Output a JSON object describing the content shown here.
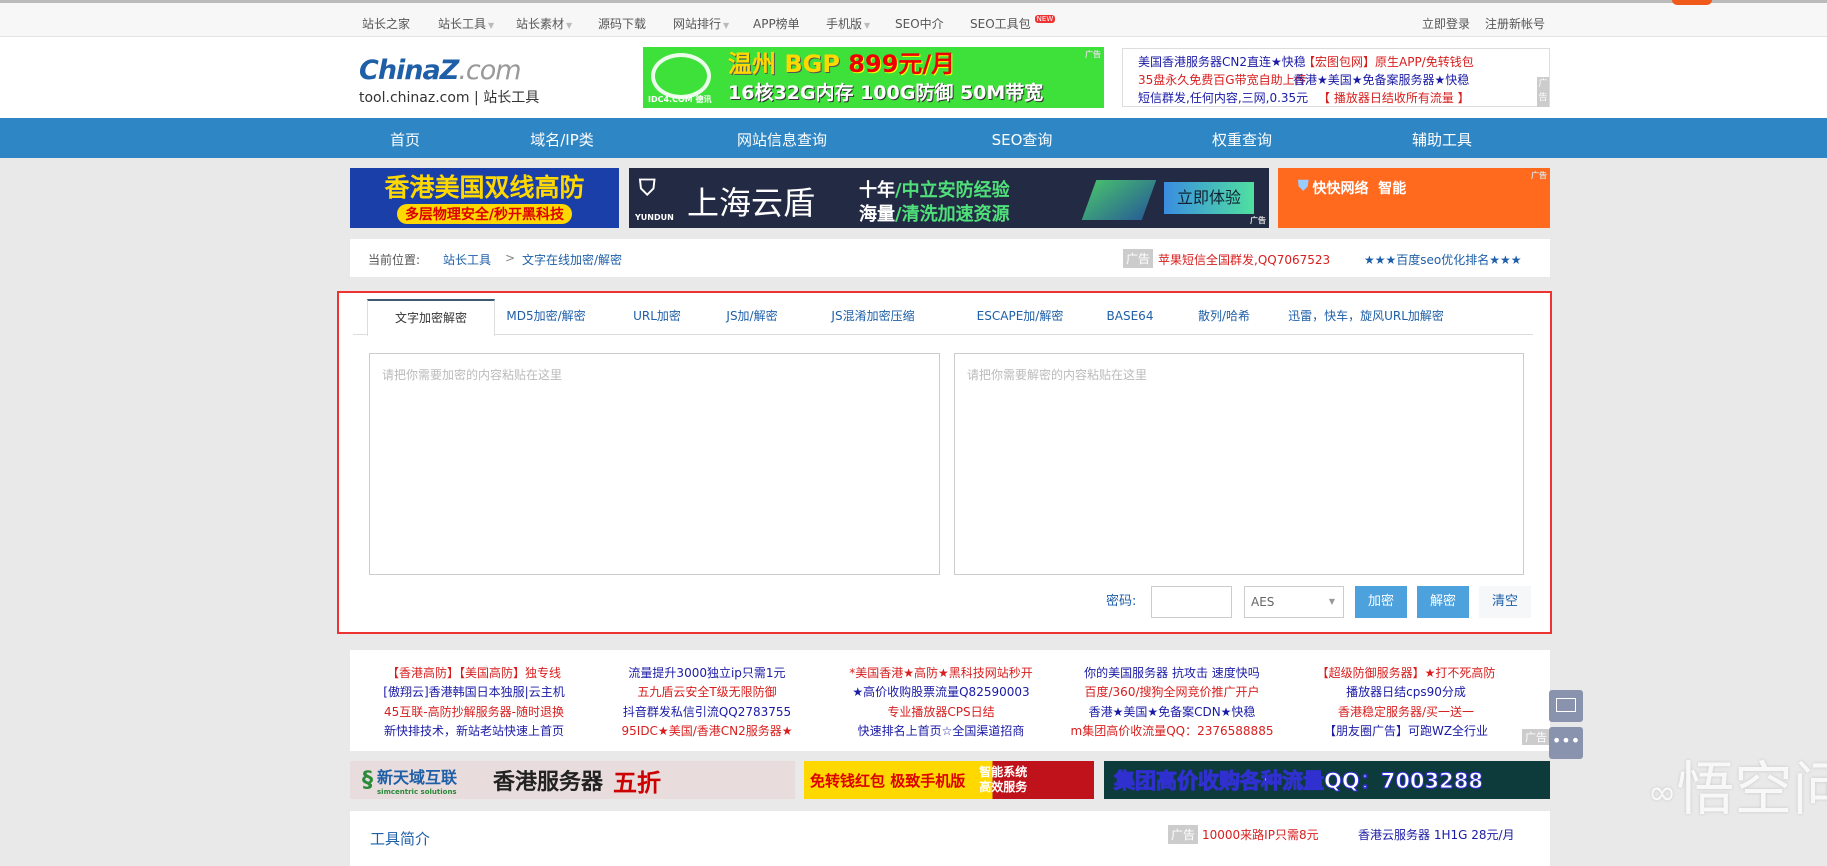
{
  "topnav": {
    "items": [
      {
        "label": "站长之家",
        "caret": false
      },
      {
        "label": "站长工具",
        "caret": true
      },
      {
        "label": "站长素材",
        "caret": true
      },
      {
        "label": "源码下载",
        "caret": false
      },
      {
        "label": "网站排行",
        "caret": true
      },
      {
        "label": "APP榜单",
        "caret": false
      },
      {
        "label": "手机版",
        "caret": true
      },
      {
        "label": "SEO中介",
        "caret": false
      },
      {
        "label": "SEO工具包",
        "caret": false
      }
    ],
    "new_badge": "NEW",
    "login": "立即登录",
    "register": "注册新帐号"
  },
  "logo": {
    "brand": "ChinaZ",
    "brand_suffix": ".com",
    "sub": "tool.chinaz.com | 站长工具"
  },
  "header_banner": {
    "line1_a": "温州 BGP ",
    "line1_b": "899元/月",
    "line2": "16核32G内存 100G防御 50M带宽",
    "brand": "IDC4.COM 德讯",
    "tag": "广告"
  },
  "header_text_ads": [
    {
      "text": "美国香港服务器CN2直连★快稳",
      "color": "#1a1aa6"
    },
    {
      "text": "【宏图包网】原生APP/免转钱包",
      "color": "#d81e1e"
    },
    {
      "text": "35盘永久免费百G带宽自助上传",
      "color": "#d81e1e"
    },
    {
      "text": "香港★美国★免备案服务器★快稳",
      "color": "#1a1aa6"
    },
    {
      "text": "短信群发,任何内容,三网,0.35元",
      "color": "#1a1aa6"
    },
    {
      "text": "【 播放器日结收所有流量 】",
      "color": "#d81e1e"
    }
  ],
  "ad_label": "广告",
  "mainnav": [
    "首页",
    "域名/IP类",
    "网站信息查询",
    "SEO查询",
    "权重查询",
    "辅助工具"
  ],
  "ads_row1": [
    {
      "l1": "香港美国双线高防",
      "l2": "多层物理安全/秒开黑科技"
    },
    {
      "brand": "YUNDUN",
      "title": "上海云盾",
      "l1a": "十年",
      "l1b": "/中立安防经验",
      "l2a": "海量",
      "l2b": "/清洗加速资源",
      "cta": "立即体验"
    },
    {
      "brand": "快快网络",
      "l1": "智能"
    }
  ],
  "breadcrumb": {
    "label": "当前位置:",
    "home": "站长工具",
    "sep": ">",
    "current": "文字在线加密/解密",
    "ad1": "苹果短信全国群发,QQ7067523",
    "ad2": "★★★百度seo优化排名★★★"
  },
  "tabs": [
    "文字加密解密",
    "MD5加密/解密",
    "URL加密",
    "JS加/解密",
    "JS混淆加密压缩",
    "ESCAPE加/解密",
    "BASE64",
    "散列/哈希",
    "迅雷，快车，旋风URL加解密"
  ],
  "encrypt": {
    "input_placeholder": "请把你需要加密的内容粘贴在这里",
    "output_placeholder": "请把你需要解密的内容粘贴在这里",
    "password_label": "密码:",
    "password_value": "",
    "algorithm": "AES",
    "encrypt_btn": "加密",
    "decrypt_btn": "解密",
    "clear_btn": "清空"
  },
  "text_links": [
    [
      {
        "t": "【香港高防】【美国高防】独专线",
        "c": "#d81e1e"
      },
      {
        "t": "[傲翔云]香港韩国日本独服|云主机",
        "c": "#1a1aa6"
      },
      {
        "t": "45互联-高防抄解服务器-随时退换",
        "c": "#d81e1e"
      },
      {
        "t": "新快排技术，新站老站快速上首页",
        "c": "#1a1aa6"
      }
    ],
    [
      {
        "t": "流量提升3000独立ip只需1元",
        "c": "#1a1aa6"
      },
      {
        "t": "五九盾云安全T级无限防御",
        "c": "#d81e1e"
      },
      {
        "t": "抖音群发私信引流QQ2783755",
        "c": "#1a1aa6"
      },
      {
        "t": "95IDC★美国/香港CN2服务器★",
        "c": "#d81e1e"
      }
    ],
    [
      {
        "t": "*美国香港★高防★黑科技网站秒开",
        "c": "#d81e1e"
      },
      {
        "t": "★高价收购股票流量Q82590003",
        "c": "#1a1aa6"
      },
      {
        "t": "专业播放器CPS日结",
        "c": "#d81e1e"
      },
      {
        "t": "快速排名上首页☆全国渠道招商",
        "c": "#1a1aa6"
      }
    ],
    [
      {
        "t": "你的美国服务器 抗攻击 速度快吗",
        "c": "#1a1aa6"
      },
      {
        "t": "百度/360/搜狗全网竞价推广开户",
        "c": "#d81e1e"
      },
      {
        "t": "香港★美国★免备案CDN★快稳",
        "c": "#1a1aa6"
      },
      {
        "t": "m集团高价收流量QQ：2376588885",
        "c": "#d81e1e"
      }
    ],
    [
      {
        "t": "【超级防御服务器】★打不死高防",
        "c": "#d81e1e"
      },
      {
        "t": "播放器日结cps90分成",
        "c": "#1a1aa6"
      },
      {
        "t": "香港稳定服务器/买一送一",
        "c": "#d81e1e"
      },
      {
        "t": "【朋友圈广告】可跑WZ全行业",
        "c": "#1a1aa6"
      }
    ]
  ],
  "ads_row2": [
    {
      "brand": "新天域互联",
      "brand_en": "simcentric solutions",
      "l1": "香港服务器",
      "l2": "五折"
    },
    {
      "l1": "免转钱红包 极致手机版",
      "l2": "智能系统 高效服务"
    },
    {
      "l1": "集团高价收购各种流量QQ：7003288"
    }
  ],
  "intro": {
    "title": "工具简介",
    "ad1": "10000来路IP只需8元",
    "ad2": "香港云服务器 1H1G 28元/月"
  },
  "watermark": "悟空问答",
  "colors": {
    "nav_blue": "#2f86c4",
    "link_blue": "#1e5fa8",
    "highlight_red": "#e33333",
    "button_blue": "#4da1dd"
  }
}
